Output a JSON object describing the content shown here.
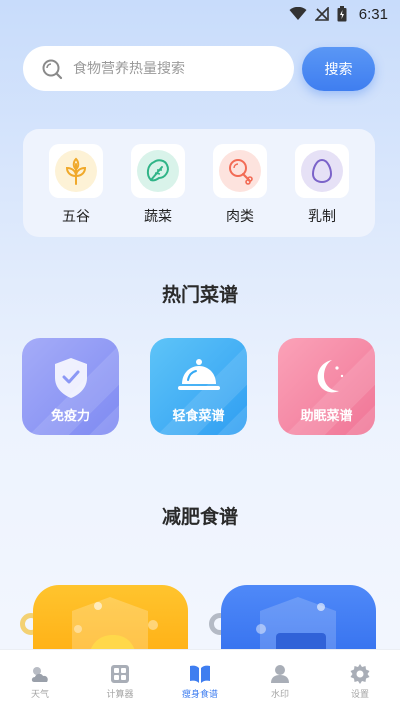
{
  "status_bar": {
    "time": "6:31"
  },
  "search": {
    "placeholder": "食物营养热量搜索",
    "button_label": "搜索"
  },
  "categories": [
    {
      "label": "五谷",
      "icon": "wheat-icon",
      "color": "#f5b62a"
    },
    {
      "label": "蔬菜",
      "icon": "vegetable-icon",
      "color": "#2fb487"
    },
    {
      "label": "肉类",
      "icon": "drumstick-icon",
      "color": "#f26b55"
    },
    {
      "label": "乳制",
      "icon": "egg-icon",
      "color": "#7b63c9"
    }
  ],
  "hot_section": {
    "title": "热门菜谱",
    "items": [
      {
        "label": "免疫力",
        "icon": "shield-icon",
        "color": "#8b98f5"
      },
      {
        "label": "轻食菜谱",
        "icon": "food-cloche-icon",
        "color": "#35a9f4"
      },
      {
        "label": "助眠菜谱",
        "icon": "moon-icon",
        "color": "#f58aa7"
      }
    ]
  },
  "diet_section": {
    "title": "减肥食谱"
  },
  "bottom_nav": [
    {
      "label": "天气",
      "icon": "weather-icon",
      "active": false
    },
    {
      "label": "计算器",
      "icon": "calculator-icon",
      "active": false
    },
    {
      "label": "瘦身食谱",
      "icon": "book-icon",
      "active": true
    },
    {
      "label": "水印",
      "icon": "person-icon",
      "active": false
    },
    {
      "label": "设置",
      "icon": "gear-icon",
      "active": false
    }
  ]
}
